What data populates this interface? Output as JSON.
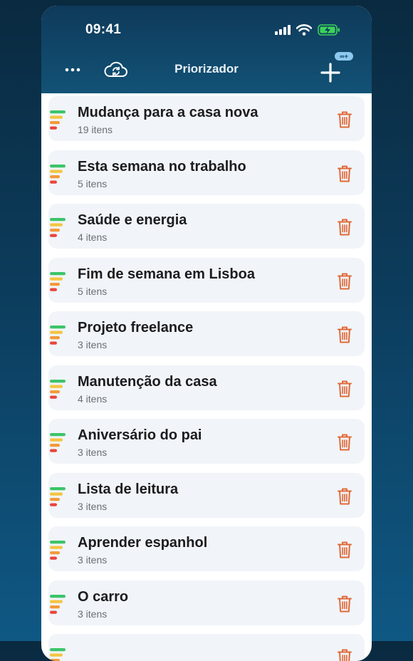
{
  "status": {
    "time": "09:41"
  },
  "header": {
    "title": "Priorizador",
    "add_badge": "∞+"
  },
  "colors": {
    "accent": "#e06a3a",
    "header_bg": "#125276",
    "card_bg": "#f1f4f8",
    "prio_green": "#3cc469",
    "prio_yellow": "#f4c542",
    "prio_orange": "#f39a3a",
    "prio_red": "#e8453c"
  },
  "lists": [
    {
      "title": "Mudança para a casa nova",
      "subtitle": "19 itens"
    },
    {
      "title": "Esta semana no trabalho",
      "subtitle": "5 itens"
    },
    {
      "title": "Saúde e energia",
      "subtitle": "4 itens"
    },
    {
      "title": "Fim de semana em Lisboa",
      "subtitle": "5 itens"
    },
    {
      "title": "Projeto freelance",
      "subtitle": "3 itens"
    },
    {
      "title": "Manutenção da casa",
      "subtitle": "4 itens"
    },
    {
      "title": "Aniversário do pai",
      "subtitle": "3 itens"
    },
    {
      "title": "Lista de leitura",
      "subtitle": "3 itens"
    },
    {
      "title": "Aprender espanhol",
      "subtitle": "3 itens"
    },
    {
      "title": "O carro",
      "subtitle": "3 itens"
    },
    {
      "title": "",
      "subtitle": ""
    }
  ]
}
